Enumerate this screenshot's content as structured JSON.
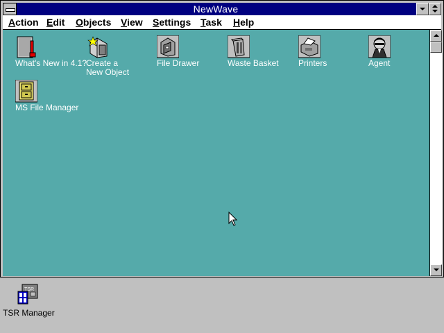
{
  "window": {
    "title": "NewWave"
  },
  "menu": {
    "items": [
      {
        "mnemonic": "A",
        "rest": "ction"
      },
      {
        "mnemonic": "E",
        "rest": "dit"
      },
      {
        "mnemonic": "O",
        "rest": "bjects"
      },
      {
        "mnemonic": "V",
        "rest": "iew"
      },
      {
        "mnemonic": "S",
        "rest": "ettings"
      },
      {
        "mnemonic": "T",
        "rest": "ask"
      },
      {
        "mnemonic": "H",
        "rest": "elp"
      }
    ]
  },
  "workspace": {
    "background_color": "#55aaaa",
    "icons": [
      {
        "icon": "document-icon",
        "label_line1": "What's New in 4.1?",
        "label_line2": ""
      },
      {
        "icon": "create-object-icon",
        "label_line1": "Create a",
        "label_line2": "New Object"
      },
      {
        "icon": "file-drawer-icon",
        "label_line1": "File Drawer",
        "label_line2": ""
      },
      {
        "icon": "waste-basket-icon",
        "label_line1": "Waste Basket",
        "label_line2": ""
      },
      {
        "icon": "printers-icon",
        "label_line1": "Printers",
        "label_line2": ""
      },
      {
        "icon": "agent-icon",
        "label_line1": "Agent",
        "label_line2": ""
      },
      {
        "icon": "file-cabinet-icon",
        "label_line1": "MS File Manager",
        "label_line2": ""
      }
    ]
  },
  "desktop": {
    "background_color": "#c0c0c0",
    "minimized": {
      "icon": "tsr-manager-icon",
      "icon_text": "TSR",
      "label": "TSR Manager"
    }
  },
  "colors": {
    "titlebar": "#000080",
    "window_frame": "#c0c0c0"
  }
}
